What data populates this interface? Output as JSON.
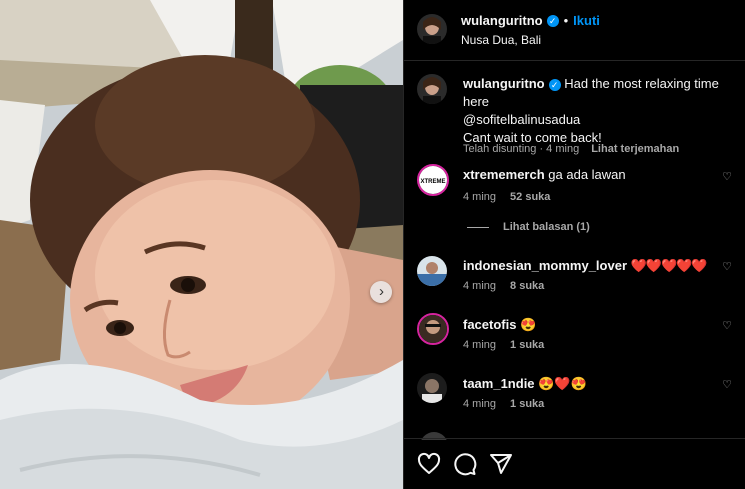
{
  "post": {
    "author": "wulanguritno",
    "follow_label": "Ikuti",
    "location": "Nusa Dua, Bali",
    "caption_line1": "Had the most relaxing time here",
    "caption_line2": "@sofitelbalinusadua",
    "caption_line3": "Cant wait to come back!",
    "caption_meta_edited": "Telah disunting",
    "caption_meta_time": "4 ming",
    "caption_meta_translate": "Lihat terjemahan"
  },
  "comments": [
    {
      "username": "xtrememerch",
      "text": "ga ada lawan",
      "time": "4 ming",
      "likes": "52 suka",
      "avatar_label": "XTREME"
    },
    {
      "username": "indonesian_mommy_lover",
      "text": "❤️❤️❤️❤️❤️",
      "time": "4 ming",
      "likes": "8 suka"
    },
    {
      "username": "facetofis",
      "text": "😍",
      "time": "4 ming",
      "likes": "1 suka"
    },
    {
      "username": "taam_1ndie",
      "text": "😍❤️😍",
      "time": "4 ming",
      "likes": "1 suka"
    }
  ],
  "replies_label": "Lihat balasan (1)",
  "colors": {
    "accent": "#0095f6",
    "bg": "#000000",
    "muted": "#a8a8a8"
  },
  "icons": [
    "chevron-right-icon",
    "verified-icon",
    "heart-icon",
    "comment-icon",
    "share-icon"
  ]
}
